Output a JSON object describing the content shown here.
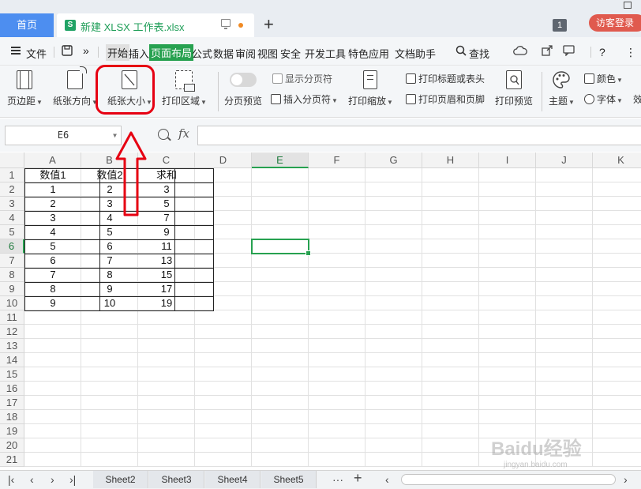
{
  "titlebar": {
    "home_tab": "首页",
    "doc_icon": "S",
    "doc_tab": "新建 XLSX 工作表.xlsx",
    "new_tab": "+",
    "window_count": "1",
    "visitor_button": "访客登录"
  },
  "menu": {
    "file": "文件",
    "more": "»",
    "items": [
      "开始",
      "插入",
      "页面布局",
      "公式",
      "数据",
      "审阅",
      "视图",
      "安全",
      "开发工具",
      "特色应用",
      "文档助手"
    ],
    "search": "查找",
    "help": "?",
    "more_dots": "⋮"
  },
  "ribbon": {
    "margins": "页边距",
    "orientation": "纸张方向",
    "paper_size": "纸张大小",
    "print_area": "打印区域",
    "page_preview": "分页预览",
    "show_page_break": "显示分页符",
    "insert_page_break": "插入分页符",
    "print_scaling": "打印缩放",
    "print_titles": "打印标题或表头",
    "print_header_footer": "打印页眉和页脚",
    "print_preview": "打印预览",
    "theme": "主题",
    "colors": "颜色",
    "fonts": "字体",
    "effects": "效"
  },
  "formula_bar": {
    "name_box": "E6",
    "fx": "fx",
    "value": ""
  },
  "sheet": {
    "columns": [
      "A",
      "B",
      "C",
      "D",
      "E",
      "F",
      "G",
      "H",
      "I",
      "J",
      "K"
    ],
    "active_column": "E",
    "rows": [
      "1",
      "2",
      "3",
      "4",
      "5",
      "6",
      "7",
      "8",
      "9",
      "10",
      "11",
      "12",
      "13",
      "14",
      "15",
      "16",
      "17",
      "18",
      "19",
      "20",
      "21"
    ],
    "active_row": "6",
    "header_row": [
      "数值1",
      "数值2",
      "求和"
    ],
    "data": [
      [
        "1",
        "2",
        "3"
      ],
      [
        "2",
        "3",
        "5"
      ],
      [
        "3",
        "4",
        "7"
      ],
      [
        "4",
        "5",
        "9"
      ],
      [
        "5",
        "6",
        "11"
      ],
      [
        "6",
        "7",
        "13"
      ],
      [
        "7",
        "8",
        "15"
      ],
      [
        "8",
        "9",
        "17"
      ],
      [
        "9",
        "10",
        "19"
      ]
    ]
  },
  "sheet_tabs": [
    "Sheet2",
    "Sheet3",
    "Sheet4",
    "Sheet5"
  ],
  "watermark": {
    "text": "Baidu经验",
    "sub": "jingyan.baidu.com"
  },
  "colors": {
    "accent_green": "#27a150",
    "annotation_red": "#e60012",
    "home_tab_blue": "#4d8ef0"
  }
}
